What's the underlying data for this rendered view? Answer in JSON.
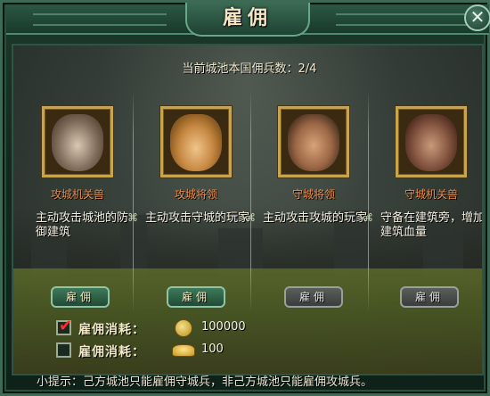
{
  "window": {
    "title": "雇佣",
    "close_icon": "close-icon"
  },
  "header": {
    "count_text": "当前城池本国佣兵数：2/4"
  },
  "cards": [
    {
      "name": "攻城机关兽",
      "desc": "主动攻击城池的防御建筑",
      "button": "雇佣",
      "button_state": "active",
      "portrait": "mech-beast-helmet"
    },
    {
      "name": "攻城将领",
      "desc": "主动攻击守城的玩家",
      "button": "雇佣",
      "button_state": "active",
      "portrait": "attack-general"
    },
    {
      "name": "守城将领",
      "desc": "主动攻击攻城的玩家",
      "button": "雇佣",
      "button_state": "disabled",
      "portrait": "defense-general"
    },
    {
      "name": "守城机关兽",
      "desc": "守备在建筑旁，增加建筑血量",
      "button": "雇佣",
      "button_state": "disabled",
      "portrait": "guard-beast"
    }
  ],
  "costs": [
    {
      "label": "雇佣消耗：",
      "checked": true,
      "icon": "copper-coin-icon",
      "value": "100000"
    },
    {
      "label": "雇佣消耗：",
      "checked": false,
      "icon": "gold-ingot-icon",
      "value": "100"
    }
  ],
  "tip": "小提示：己方城池只能雇佣守城兵，非己方城池只能雇佣攻城兵。",
  "colors": {
    "name_text": "#e88b4a",
    "button_active": "#3e7a5a",
    "button_disabled": "#5b5f5c",
    "checkbox_tick": "#ff2a2a"
  }
}
